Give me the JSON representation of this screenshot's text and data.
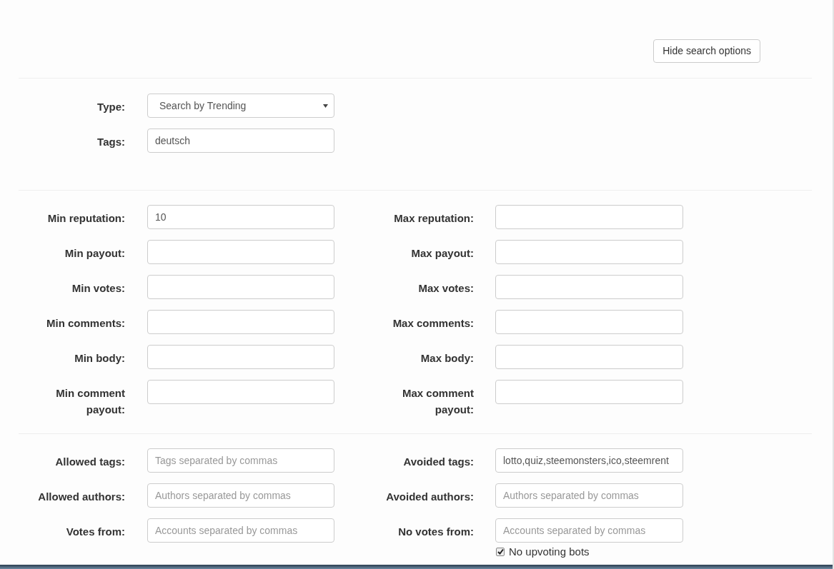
{
  "hide_button": "Hide search options",
  "basic": [
    {
      "label": "Type:",
      "kind": "select",
      "value": "Search by Trending"
    },
    {
      "label": "Tags:",
      "kind": "text",
      "value": "deutsch"
    }
  ],
  "ranges": [
    {
      "left": {
        "label": "Min reputation:",
        "value": "10"
      },
      "right": {
        "label": "Max reputation:"
      }
    },
    {
      "left": {
        "label": "Min payout:"
      },
      "right": {
        "label": "Max payout:"
      }
    },
    {
      "left": {
        "label": "Min votes:"
      },
      "right": {
        "label": "Max votes:"
      }
    },
    {
      "left": {
        "label": "Min comments:"
      },
      "right": {
        "label": "Max comments:"
      }
    },
    {
      "left": {
        "label": "Min body:"
      },
      "right": {
        "label": "Max body:"
      }
    },
    {
      "left": {
        "label": "Min comment payout:"
      },
      "right": {
        "label": "Max comment payout:"
      }
    }
  ],
  "filters": [
    {
      "left": {
        "label": "Allowed tags:",
        "placeholder": "Tags separated by commas"
      },
      "right": {
        "label": "Avoided tags:",
        "value": "lotto,quiz,steemonsters,ico,steemrent"
      }
    },
    {
      "left": {
        "label": "Allowed authors:",
        "placeholder": "Authors separated by commas"
      },
      "right": {
        "label": "Avoided authors:",
        "placeholder": "Authors separated by commas"
      }
    },
    {
      "left": {
        "label": "Votes from:",
        "placeholder": "Accounts separated by commas"
      },
      "right": {
        "label": "No votes from:",
        "placeholder": "Accounts separated by commas"
      }
    }
  ],
  "checkbox": {
    "label": "No upvoting bots",
    "checked": true
  }
}
